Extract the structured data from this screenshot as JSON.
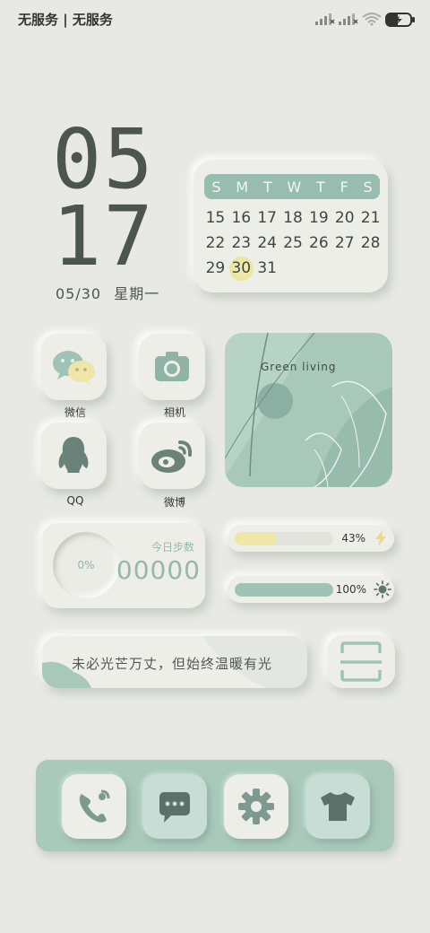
{
  "status_bar": {
    "carrier": "无服务 | 无服务"
  },
  "clock": {
    "hour": "05",
    "minute": "17",
    "date": "05/30",
    "weekday": "星期一"
  },
  "calendar": {
    "weekdays": [
      "S",
      "M",
      "T",
      "W",
      "T",
      "F",
      "S"
    ],
    "days": [
      "15",
      "16",
      "17",
      "18",
      "19",
      "20",
      "21",
      "22",
      "23",
      "24",
      "25",
      "26",
      "27",
      "28",
      "29",
      "30",
      "31"
    ],
    "today": "30"
  },
  "apps": [
    {
      "label": "微信",
      "icon": "wechat-icon"
    },
    {
      "label": "相机",
      "icon": "camera-icon"
    },
    {
      "label": "QQ",
      "icon": "qq-icon"
    },
    {
      "label": "微博",
      "icon": "weibo-icon"
    }
  ],
  "green_widget": {
    "title": "Green living"
  },
  "steps_widget": {
    "percent": "0%",
    "label": "今日步数",
    "count": "00000"
  },
  "battery_bar": {
    "percent_text": "43%",
    "value": 0.43,
    "color": "#f0e6a6",
    "icon": "lightning-icon"
  },
  "brightness_bar": {
    "percent_text": "100%",
    "value": 1.0,
    "color": "#9fc4b7",
    "icon": "sun-icon"
  },
  "quote": {
    "text": "未必光芒万丈，但始终温暖有光"
  },
  "scan": {
    "icon": "scan-icon"
  },
  "dock": [
    {
      "icon": "phone-icon"
    },
    {
      "icon": "message-icon"
    },
    {
      "icon": "settings-gear-icon"
    },
    {
      "icon": "tshirt-theme-icon"
    }
  ],
  "colors": {
    "accent_green": "#96bdb0",
    "accent_yellow": "#ebe59a",
    "background": "#e8e9e4",
    "text_dark": "#4d5550"
  }
}
